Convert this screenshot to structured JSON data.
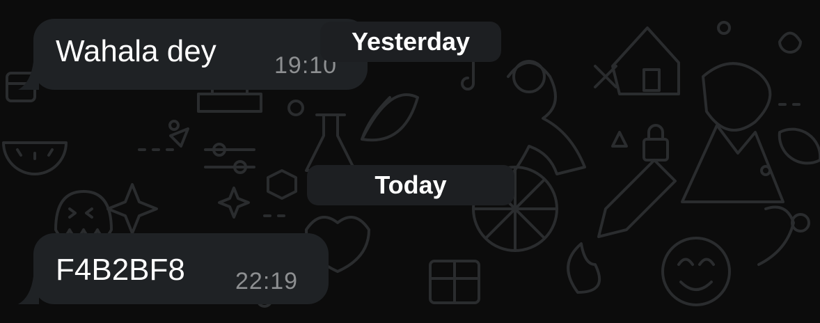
{
  "messages": [
    {
      "text": "Wahala dey",
      "time": "19:10",
      "direction": "incoming"
    },
    {
      "text": "F4B2BF8",
      "time": "22:19",
      "direction": "incoming"
    }
  ],
  "date_separators": {
    "yesterday": "Yesterday",
    "today": "Today"
  },
  "colors": {
    "background": "#0c0c0c",
    "bubble": "#1f2225",
    "chip": "#1d1f22",
    "text": "#ffffff",
    "timestamp": "#8d8f91",
    "wallpaper_doodle": "#2a2c2e"
  }
}
